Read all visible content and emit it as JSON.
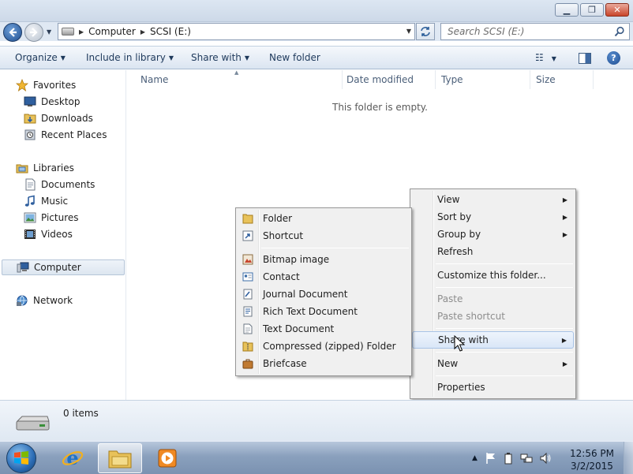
{
  "navigation": {
    "breadcrumbs": [
      "Computer",
      "SCSI (E:)"
    ],
    "search_placeholder": "Search SCSI (E:)"
  },
  "commands": {
    "organize": "Organize",
    "include_in_library": "Include in library",
    "share_with": "Share with",
    "new_folder": "New folder"
  },
  "nav_pane": {
    "favorites": {
      "label": "Favorites",
      "items": [
        "Desktop",
        "Downloads",
        "Recent Places"
      ]
    },
    "libraries": {
      "label": "Libraries",
      "items": [
        "Documents",
        "Music",
        "Pictures",
        "Videos"
      ]
    },
    "computer": "Computer",
    "network": "Network"
  },
  "columns": [
    "Name",
    "Date modified",
    "Type",
    "Size"
  ],
  "empty_message": "This folder is empty.",
  "context_menu": {
    "items": [
      "View",
      "Sort by",
      "Group by",
      "Refresh",
      "Customize this folder...",
      "Paste",
      "Paste shortcut",
      "Share with",
      "New",
      "Properties"
    ]
  },
  "new_submenu": {
    "items": [
      "Folder",
      "Shortcut",
      "Bitmap image",
      "Contact",
      "Journal Document",
      "Rich Text Document",
      "Text Document",
      "Compressed (zipped) Folder",
      "Briefcase"
    ]
  },
  "details": {
    "item_count": "0 items"
  },
  "taskbar": {
    "time": "12:56 PM",
    "date": "3/2/2015"
  },
  "icons": {
    "favorites": "star-icon",
    "desktop": "desktop-icon",
    "downloads": "downloads-folder-icon",
    "recent_places": "recent-places-icon",
    "libraries": "libraries-icon",
    "documents": "documents-icon",
    "music": "music-icon",
    "pictures": "pictures-icon",
    "videos": "videos-icon",
    "computer": "computer-icon",
    "network": "network-icon"
  },
  "colors": {
    "accent": "#1e395b",
    "selection": "#dde6f0",
    "menu_bg": "#f0f0f0",
    "menu_highlight": "#d9e6f7"
  }
}
